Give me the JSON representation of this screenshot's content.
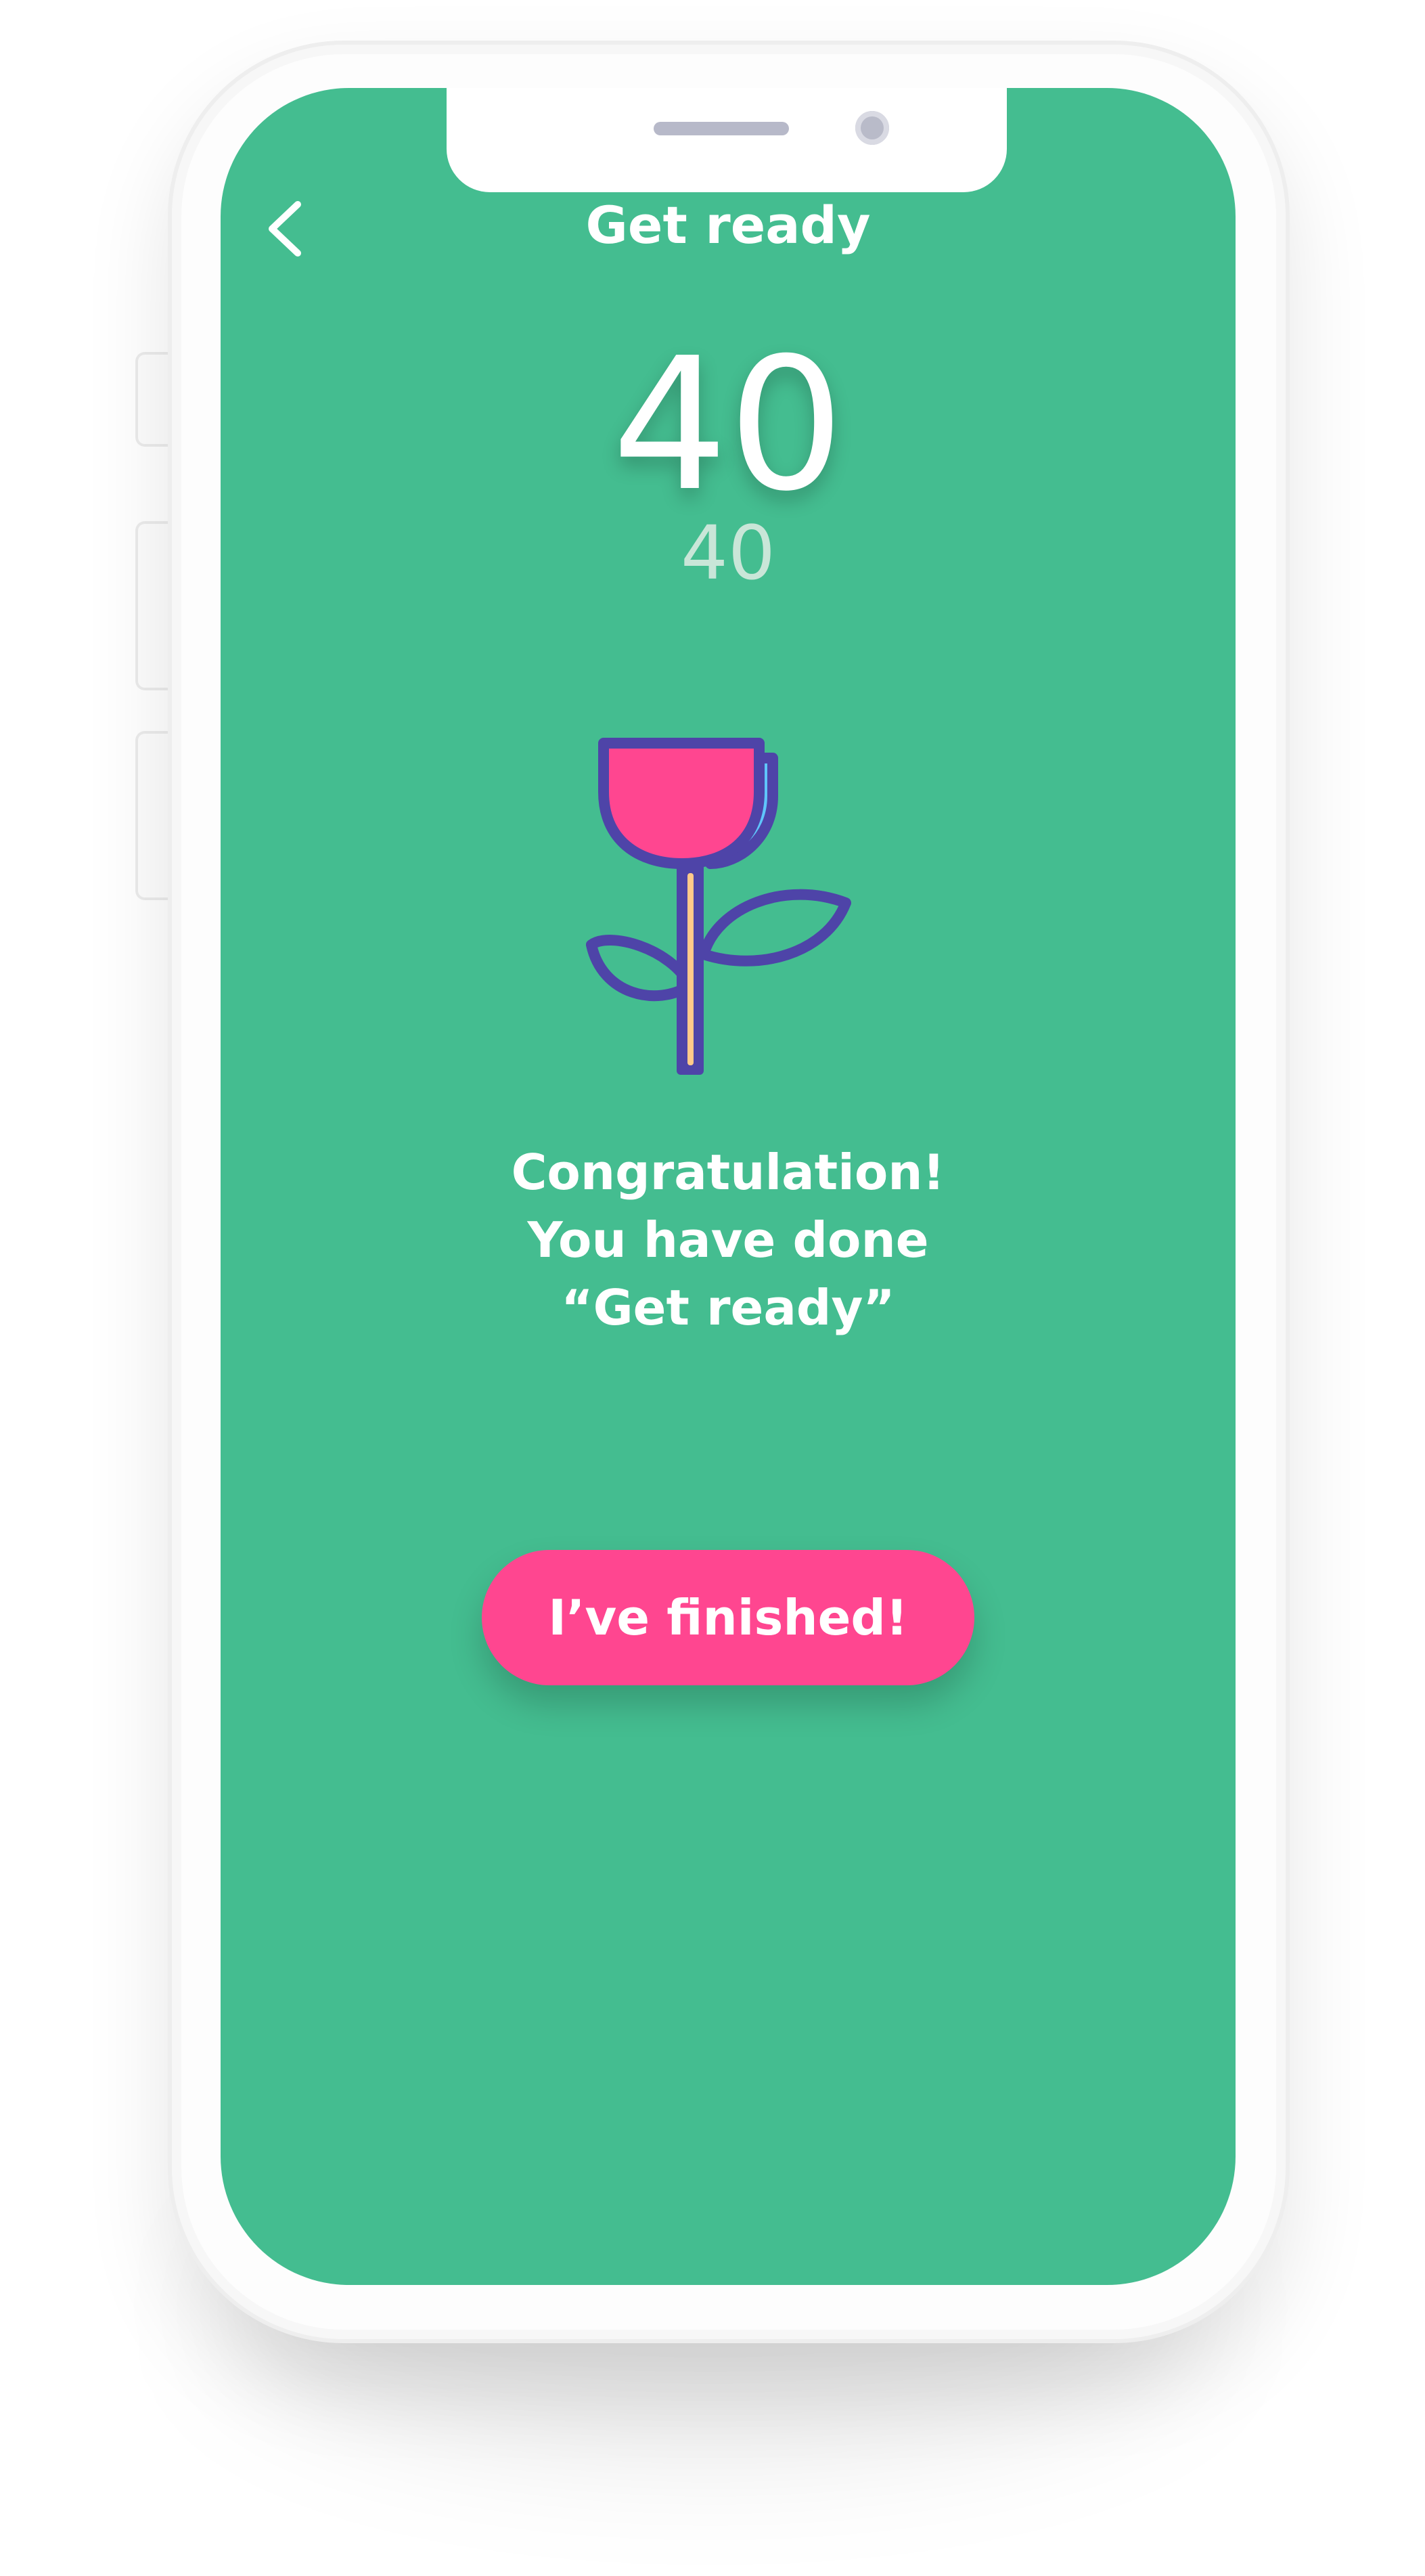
{
  "header": {
    "title": "Get ready",
    "back_icon": "chevron-left-icon"
  },
  "counter": {
    "current": "40",
    "total": "40"
  },
  "illustration": {
    "icon": "flower-icon",
    "colors": {
      "petal_front": "#ff4690",
      "petal_back": "#5fc5fb",
      "outline": "#4e44a8",
      "stem_highlight": "#ffc98a"
    }
  },
  "message": {
    "lines": [
      "Congratulation!",
      "You have done",
      "“Get ready”"
    ]
  },
  "actions": {
    "finish_label": "I’ve finished!"
  },
  "theme": {
    "background": "#44bd90",
    "accent": "#ff4690",
    "text": "#ffffff"
  }
}
